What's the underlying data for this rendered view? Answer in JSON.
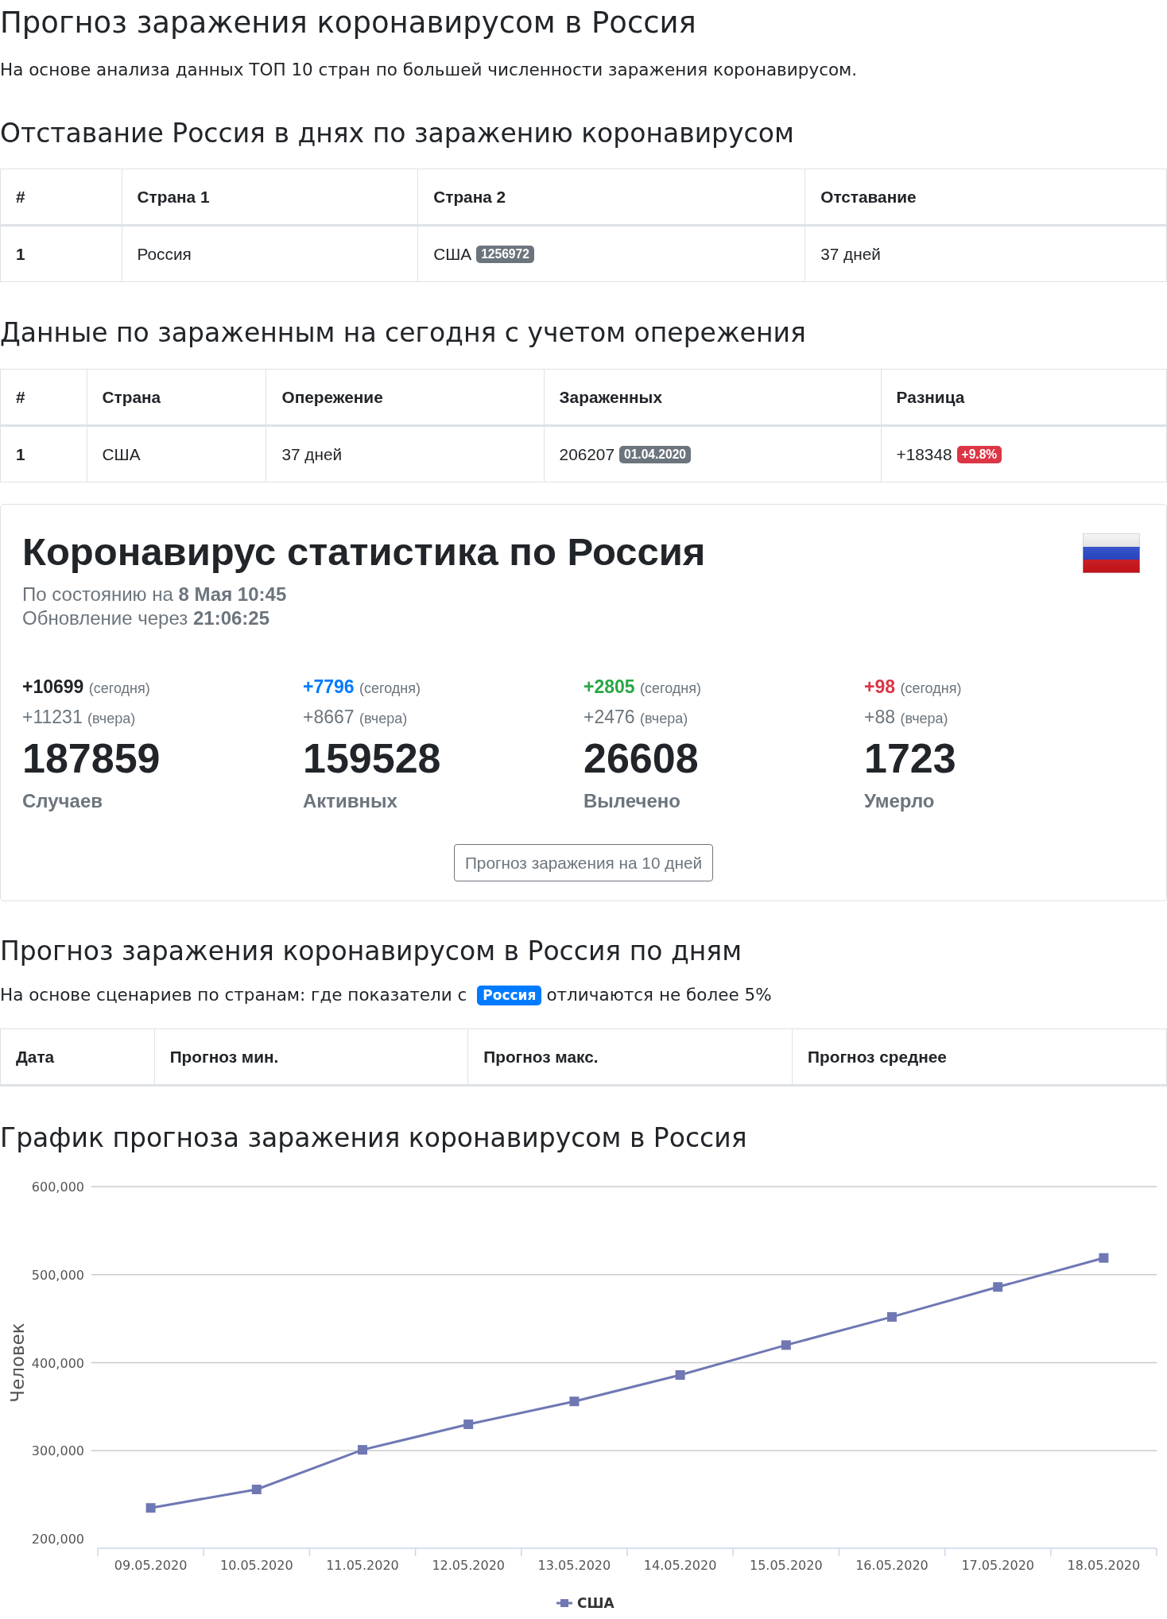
{
  "header": {
    "title": "Прогноз заражения коронавирусом в Россия",
    "subtitle": "На основе анализа данных ТОП 10 стран по большей численности заражения коронавирусом."
  },
  "lag_section": {
    "title": "Отставание Россия в днях по заражению коронавирусом",
    "table": {
      "columns": [
        "#",
        "Страна 1",
        "Страна 2",
        "Отставание"
      ],
      "rows": [
        [
          {
            "text": "1"
          },
          {
            "text": "Россия"
          },
          {
            "text": "США",
            "badge": {
              "text": "1256972",
              "kind": "secondary"
            }
          },
          {
            "text": "37 дней"
          }
        ]
      ]
    }
  },
  "today_section": {
    "title": "Данные по зараженным на сегодня с учетом опережения",
    "table": {
      "columns": [
        "#",
        "Страна",
        "Опережение",
        "Зараженных",
        "Разница"
      ],
      "rows": [
        [
          {
            "text": "1"
          },
          {
            "text": "США"
          },
          {
            "text": "37 дней"
          },
          {
            "text": "206207",
            "badge": {
              "text": "01.04.2020",
              "kind": "secondary"
            }
          },
          {
            "text": "+18348",
            "badge": {
              "text": "+9.8%",
              "kind": "danger"
            }
          }
        ]
      ]
    }
  },
  "stats_card": {
    "title": "Коронавирус статистика по Россия",
    "status": "По состоянию на **8 Мая 10:45**",
    "update": "Обновление через **21:06:25**",
    "stats": [
      {
        "kind": "dark",
        "today": "+10699",
        "today_label": "(сегодня)",
        "yesterday": "+11231",
        "yesterday_label": "(вчера)",
        "total": "187859",
        "label": "Случаев"
      },
      {
        "kind": "primary",
        "today": "+7796",
        "today_label": "(сегодня)",
        "yesterday": "+8667",
        "yesterday_label": "(вчера)",
        "total": "159528",
        "label": "Активных"
      },
      {
        "kind": "success",
        "today": "+2805",
        "today_label": "(сегодня)",
        "yesterday": "+2476",
        "yesterday_label": "(вчера)",
        "total": "26608",
        "label": "Вылечено"
      },
      {
        "kind": "danger",
        "today": "+98",
        "today_label": "(сегодня)",
        "yesterday": "+88",
        "yesterday_label": "(вчера)",
        "total": "1723",
        "label": "Умерло"
      }
    ],
    "button": "Прогноз заражения на 10 дней"
  },
  "forecast_section": {
    "title": "Прогноз заражения коронавирусом в Россия по дням",
    "note": {
      "before": "На основе сценариев по странам: где показатели с",
      "badge": {
        "text": "Россия",
        "kind": "primary"
      },
      "after": "отличаются не более 5%"
    },
    "table": {
      "columns": [
        "Дата",
        "Прогноз мин.",
        "Прогноз макс.",
        "Прогноз среднее"
      ]
    }
  },
  "chart_section": {
    "title": "График прогноза заражения коронавирусом в Россия",
    "chart_data": {
      "type": "line",
      "grid": true,
      "ylabel": "Человек",
      "categories": [
        "09.05.2020",
        "10.05.2020",
        "11.05.2020",
        "12.05.2020",
        "13.05.2020",
        "14.05.2020",
        "15.05.2020",
        "16.05.2020",
        "17.05.2020",
        "18.05.2020"
      ],
      "series": [
        {
          "name": "США",
          "color": "#6f78b3",
          "marker": "square",
          "values": [
            235000,
            256000,
            301000,
            330000,
            356000,
            386000,
            420000,
            452000,
            486000,
            519000
          ]
        }
      ],
      "ylim": [
        200000,
        600000
      ],
      "yticks": [
        {
          "value": 200000,
          "label": "200,000"
        },
        {
          "value": 300000,
          "label": "300,000"
        },
        {
          "value": 400000,
          "label": "400,000"
        },
        {
          "value": 500000,
          "label": "500,000"
        },
        {
          "value": 600000,
          "label": "600,000"
        }
      ]
    }
  }
}
